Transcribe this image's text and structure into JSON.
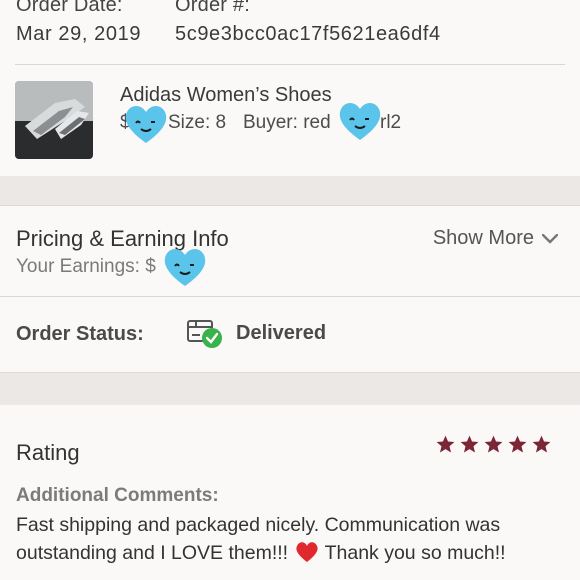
{
  "order": {
    "date_label": "Order Date:",
    "date_value": "Mar 29, 2019",
    "number_label": "Order #:",
    "number_value": "5c9e3bcc0ac17f5621ea6df4"
  },
  "product": {
    "title": "Adidas Women’s Shoes",
    "price_prefix": "$",
    "size_text": "Size: 8",
    "buyer_label": "Buyer: red",
    "buyer_suffix": "rl2"
  },
  "pricing": {
    "title": "Pricing & Earning Info",
    "earnings_label": "Your Earnings: $",
    "show_more": "Show More"
  },
  "status": {
    "label": "Order Status:",
    "value": "Delivered",
    "icon": "package-delivered-icon"
  },
  "rating": {
    "title": "Rating",
    "stars": 5,
    "star_color": "#7b2535"
  },
  "comments": {
    "label": "Additional Comments:",
    "text_part1": "Fast shipping and packaged nicely. Communication was outstanding and I LOVE them!!!",
    "text_part2": "Thank you so much!!"
  },
  "colors": {
    "sticker_blue": "#5bc4ea",
    "check_green": "#38b24a",
    "band": "#ebe8e6"
  }
}
